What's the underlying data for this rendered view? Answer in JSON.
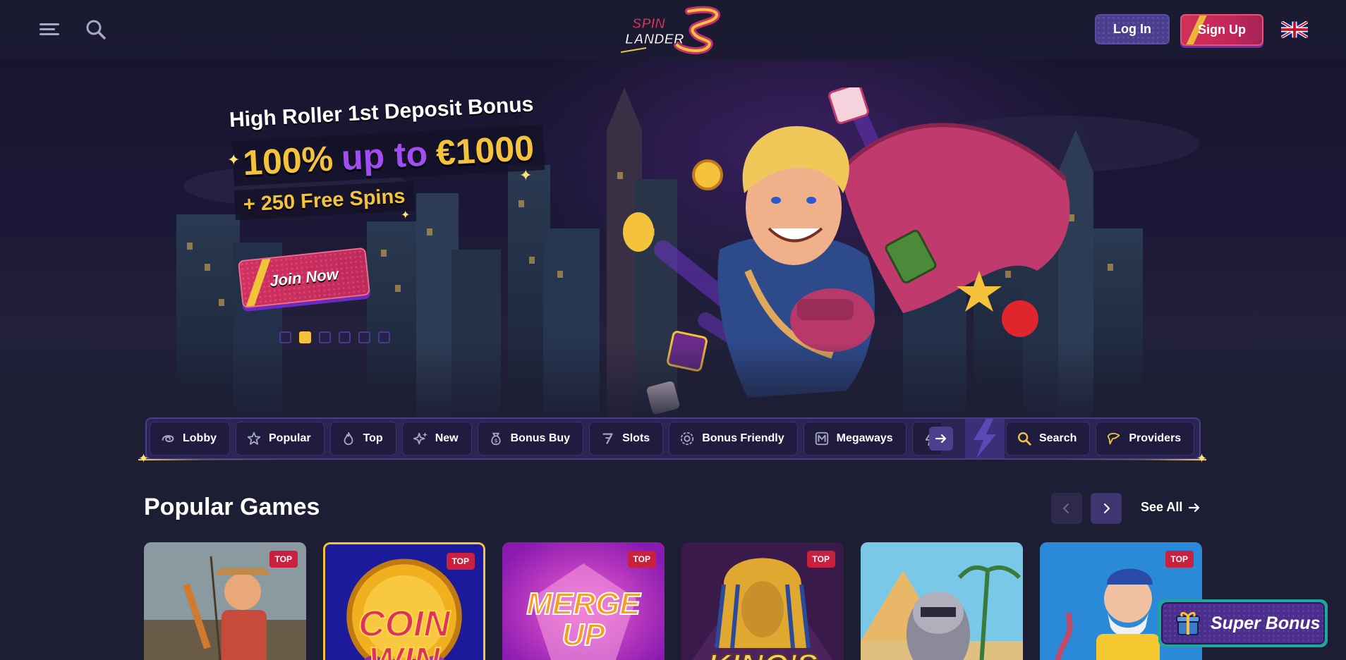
{
  "header": {
    "logo_text_top": "SPIN",
    "logo_text_bottom": "LANDER",
    "login_label": "Log In",
    "signup_label": "Sign Up",
    "language_icon": "uk-flag-icon"
  },
  "hero": {
    "title": "High Roller 1st Deposit Bonus",
    "offer_percent": "100%",
    "offer_mid": "up to",
    "offer_amount": "€1000",
    "spins": "+ 250 Free Spins",
    "cta_label": "Join Now",
    "slides_total": 6,
    "active_slide": 2
  },
  "categories": {
    "items": [
      {
        "label": "Lobby",
        "icon": "lobby-icon"
      },
      {
        "label": "Popular",
        "icon": "star-icon"
      },
      {
        "label": "Top",
        "icon": "flame-icon"
      },
      {
        "label": "New",
        "icon": "sparkle-icon"
      },
      {
        "label": "Bonus Buy",
        "icon": "money-bag-icon"
      },
      {
        "label": "Slots",
        "icon": "seven-icon"
      },
      {
        "label": "Bonus Friendly",
        "icon": "bonus-chip-icon"
      },
      {
        "label": "Megaways",
        "icon": "megaways-icon"
      }
    ],
    "search_label": "Search",
    "providers_label": "Providers"
  },
  "popular": {
    "title": "Popular Games",
    "see_all_label": "See All",
    "games": [
      {
        "badge": "TOP",
        "title": "",
        "theme": "fisherman"
      },
      {
        "badge": "TOP",
        "title": "COIN WIN",
        "theme": "coin"
      },
      {
        "badge": "TOP",
        "title": "MERGE UP",
        "theme": "merge"
      },
      {
        "badge": "TOP",
        "title": "KING'S",
        "theme": "pharaoh"
      },
      {
        "badge": "",
        "title": "",
        "theme": "raccoon"
      },
      {
        "badge": "TOP",
        "title": "",
        "theme": "sailor"
      }
    ]
  },
  "super_bonus": {
    "label": "Super Bonus"
  },
  "colors": {
    "background": "#1d1d33",
    "accent_yellow": "#f5c33b",
    "accent_purple": "#a14df2",
    "accent_pink": "#d2305a",
    "badge_red": "#c8203e"
  }
}
